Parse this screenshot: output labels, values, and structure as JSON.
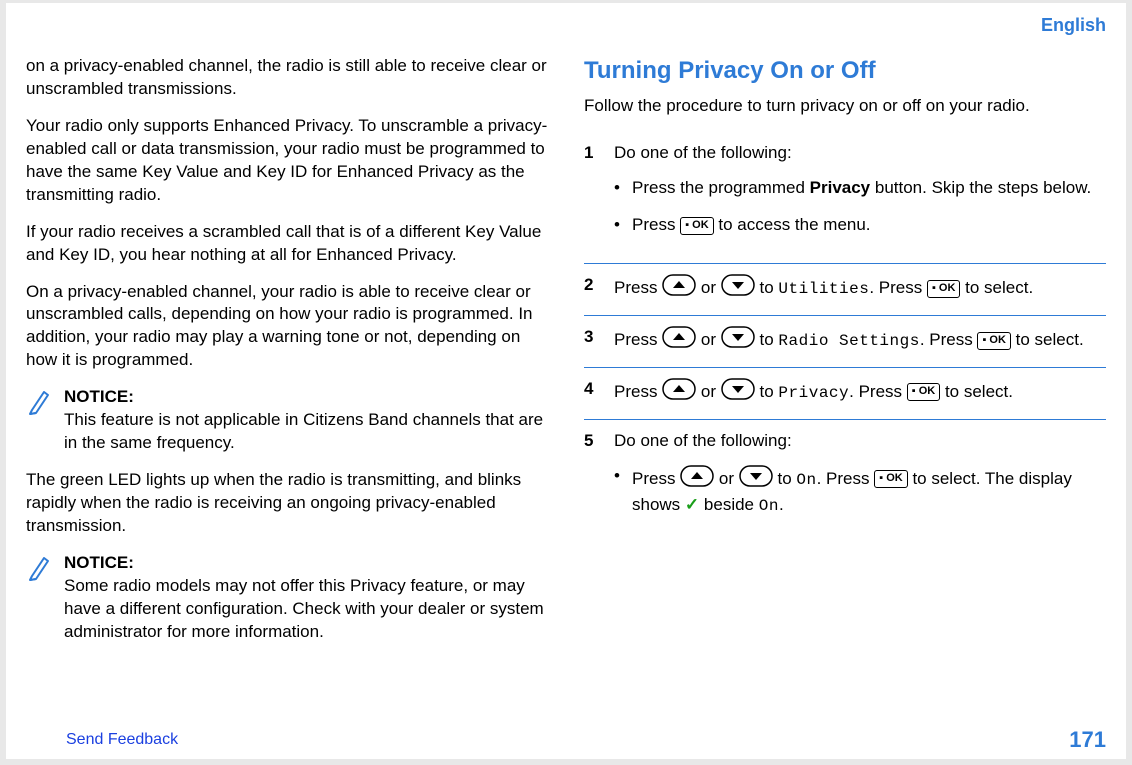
{
  "header": {
    "language": "English"
  },
  "left": {
    "p1": "on a privacy-enabled channel, the radio is still able to receive clear or unscrambled transmissions.",
    "p2": "Your radio only supports Enhanced Privacy. To unscramble a privacy-enabled call or data transmission, your radio must be programmed to have the same Key Value and Key ID for Enhanced Privacy as the transmitting radio.",
    "p3": "If your radio receives a scrambled call that is of a different Key Value and Key ID, you hear nothing at all for Enhanced Privacy.",
    "p4": "On a privacy-enabled channel, your radio is able to receive clear or unscrambled calls, depending on how your radio is programmed. In addition, your radio may play a warning tone or not, depending on how it is programmed.",
    "notice1": {
      "title": "NOTICE:",
      "body": "This feature is not applicable in Citizens Band channels that are in the same frequency."
    },
    "p5": "The green LED lights up when the radio is transmitting, and blinks rapidly when the radio is receiving an ongoing privacy-enabled transmission.",
    "notice2": {
      "title": "NOTICE:",
      "body": "Some radio models may not offer this Privacy feature, or may have a different configuration. Check with your dealer or system administrator for more information."
    }
  },
  "right": {
    "heading": "Turning Privacy On or Off",
    "intro": "Follow the procedure to turn privacy on or off on your radio.",
    "steps": {
      "s1": {
        "num": "1",
        "lead": "Do one of the following:",
        "b1a": "Press the programmed ",
        "b1b": "Privacy",
        "b1c": " button. Skip the steps below.",
        "b2a": "Press ",
        "b2b": " to access the menu."
      },
      "s2": {
        "num": "2",
        "a": "Press ",
        "b": " or ",
        "c": " to ",
        "menu": "Utilities",
        "d": ". Press ",
        "e": " to select."
      },
      "s3": {
        "num": "3",
        "a": "Press ",
        "b": " or ",
        "c": " to ",
        "menu": "Radio Settings",
        "d": ". Press ",
        "e": " to select."
      },
      "s4": {
        "num": "4",
        "a": "Press ",
        "b": " or ",
        "c": " to ",
        "menu": "Privacy",
        "d": ". Press ",
        "e": " to select."
      },
      "s5": {
        "num": "5",
        "lead": "Do one of the following:",
        "b1a": "Press ",
        "b1b": " or ",
        "b1c": " to ",
        "menu": "On",
        "b1d": ". Press ",
        "b1e": " to select. The display shows ",
        "b1f": " beside ",
        "menu2": "On",
        "b1g": "."
      }
    }
  },
  "icons": {
    "ok": "▪ OK",
    "check": "✓"
  },
  "footer": {
    "feedback": "Send Feedback",
    "page": "171"
  }
}
